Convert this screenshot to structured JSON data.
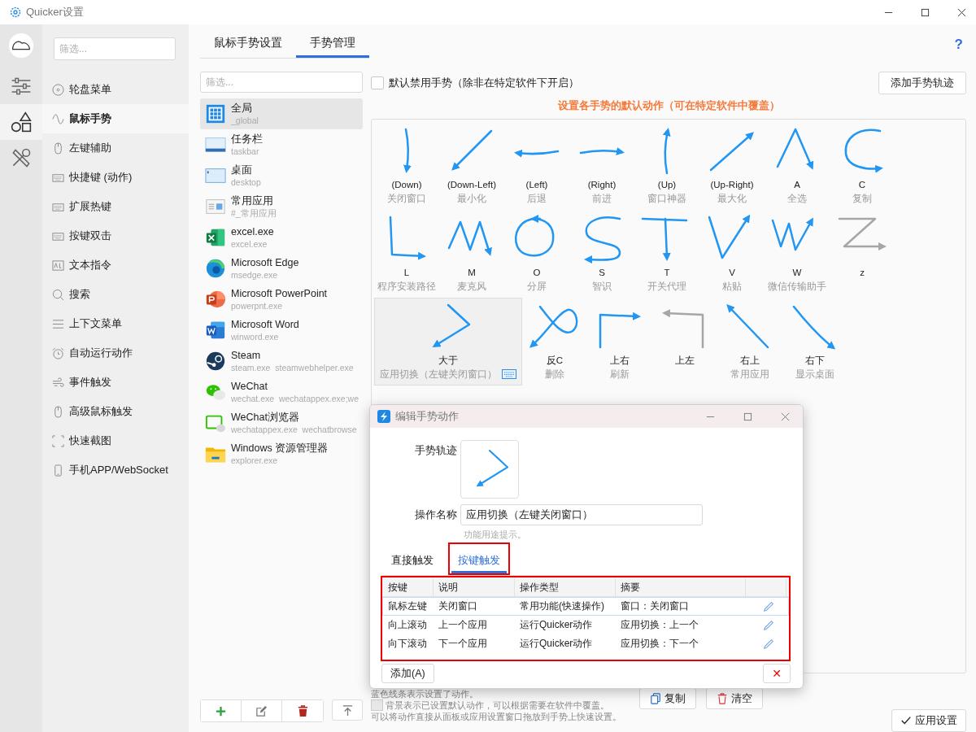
{
  "window": {
    "title": "Quicker设置"
  },
  "rail": [
    {
      "kind": "sliders",
      "selected": false
    },
    {
      "kind": "shapes",
      "selected": true
    },
    {
      "kind": "tools",
      "selected": false
    }
  ],
  "nav": {
    "filter_placeholder": "筛选...",
    "items": [
      {
        "kind": "disc",
        "label": "轮盘菜单",
        "selected": false
      },
      {
        "kind": "wave",
        "label": "鼠标手势",
        "selected": true
      },
      {
        "kind": "mouse",
        "label": "左键辅助",
        "selected": false
      },
      {
        "kind": "keyboard",
        "label": "快捷键 (动作)",
        "selected": false
      },
      {
        "kind": "keyboard",
        "label": "扩展热键",
        "selected": false
      },
      {
        "kind": "keyboard",
        "label": "按键双击",
        "selected": false
      },
      {
        "kind": "ad",
        "label": "文本指令",
        "selected": false
      },
      {
        "kind": "search",
        "label": "搜索",
        "selected": false
      },
      {
        "kind": "lines",
        "label": "上下文菜单",
        "selected": false
      },
      {
        "kind": "alarm",
        "label": "自动运行动作",
        "selected": false
      },
      {
        "kind": "wind",
        "label": "事件触发",
        "selected": false
      },
      {
        "kind": "mouse",
        "label": "高级鼠标触发",
        "selected": false
      },
      {
        "kind": "crop",
        "label": "快速截图",
        "selected": false
      },
      {
        "kind": "phone",
        "label": "手机APP/WebSocket",
        "selected": false
      }
    ]
  },
  "tabs": [
    {
      "label": "鼠标手势设置",
      "selected": false
    },
    {
      "label": "手势管理",
      "selected": true
    }
  ],
  "help": "?",
  "apps": {
    "filter_placeholder": "筛选...",
    "items": [
      {
        "kind": "global",
        "name": "全局",
        "exe": "_global",
        "selected": true
      },
      {
        "kind": "taskbar",
        "name": "任务栏",
        "exe": "taskbar",
        "selected": false
      },
      {
        "kind": "desktop",
        "name": "桌面",
        "exe": "desktop",
        "selected": false
      },
      {
        "kind": "common",
        "name": "常用应用",
        "exe": "#_常用应用",
        "selected": false
      },
      {
        "kind": "excel",
        "name": "excel.exe",
        "exe": "excel.exe",
        "selected": false
      },
      {
        "kind": "edge",
        "name": "Microsoft Edge",
        "exe": "msedge.exe",
        "selected": false
      },
      {
        "kind": "powerpoint",
        "name": "Microsoft PowerPoint",
        "exe": "powerpnt.exe",
        "selected": false
      },
      {
        "kind": "word",
        "name": "Microsoft Word",
        "exe": "winword.exe",
        "selected": false
      },
      {
        "kind": "steam",
        "name": "Steam",
        "exe": "steam.exe  steamwebhelper.exe",
        "selected": false
      },
      {
        "kind": "wechat",
        "name": "WeChat",
        "exe": "wechat.exe  wechatappex.exe;we",
        "selected": false
      },
      {
        "kind": "wechat-browser",
        "name": "WeChat浏览器",
        "exe": "wechatappex.exe  wechatbrowse",
        "selected": false
      },
      {
        "kind": "explorer",
        "name": "Windows 资源管理器",
        "exe": "explorer.exe",
        "selected": false
      }
    ]
  },
  "disable_default": {
    "label": "默认禁用手势（除非在特定软件下开启）",
    "checked": false
  },
  "add_gesture_button": "添加手势轨迹",
  "hint_title": "设置各手势的默认动作（可在特定软件中覆盖）",
  "gestures": [
    {
      "kind": "down",
      "name": "(Down)",
      "action": "关闭窗口",
      "assigned": true,
      "selected": false,
      "hotkey": false
    },
    {
      "kind": "down-left",
      "name": "(Down-Left)",
      "action": "最小化",
      "assigned": true,
      "selected": false,
      "hotkey": false
    },
    {
      "kind": "left",
      "name": "(Left)",
      "action": "后退",
      "assigned": true,
      "selected": false,
      "hotkey": false
    },
    {
      "kind": "right",
      "name": "(Right)",
      "action": "前进",
      "assigned": true,
      "selected": false,
      "hotkey": false
    },
    {
      "kind": "up",
      "name": "(Up)",
      "action": "窗口神器",
      "assigned": true,
      "selected": false,
      "hotkey": false
    },
    {
      "kind": "up-right",
      "name": "(Up-Right)",
      "action": "最大化",
      "assigned": true,
      "selected": false,
      "hotkey": false
    },
    {
      "kind": "a",
      "name": "A",
      "action": "全选",
      "assigned": true,
      "selected": false,
      "hotkey": false
    },
    {
      "kind": "c",
      "name": "C",
      "action": "复制",
      "assigned": true,
      "selected": false,
      "hotkey": false
    },
    {
      "kind": "l",
      "name": "L",
      "action": "程序安装路径",
      "assigned": true,
      "selected": false,
      "hotkey": false
    },
    {
      "kind": "m",
      "name": "M",
      "action": "麦克风",
      "assigned": true,
      "selected": false,
      "hotkey": false
    },
    {
      "kind": "o",
      "name": "O",
      "action": "分屏",
      "assigned": true,
      "selected": false,
      "hotkey": false
    },
    {
      "kind": "s",
      "name": "S",
      "action": "智识",
      "assigned": true,
      "selected": false,
      "hotkey": false
    },
    {
      "kind": "t",
      "name": "T",
      "action": "开关代理",
      "assigned": true,
      "selected": false,
      "hotkey": false
    },
    {
      "kind": "v",
      "name": "V",
      "action": "粘贴",
      "assigned": true,
      "selected": false,
      "hotkey": false
    },
    {
      "kind": "w",
      "name": "W",
      "action": "微信传输助手",
      "assigned": true,
      "selected": false,
      "hotkey": false
    },
    {
      "kind": "z",
      "name": "z",
      "assigned": false,
      "selected": false,
      "hotkey": false
    },
    {
      "kind": "gt",
      "name": "大于",
      "action": "应用切换（左键关闭窗口）",
      "assigned": true,
      "selected": true,
      "hotkey": true
    },
    {
      "kind": "reverse-c",
      "name": "反C",
      "action": "删除",
      "assigned": true,
      "selected": false,
      "hotkey": false
    },
    {
      "kind": "up-then-right",
      "name": "上右",
      "action": "刷新",
      "assigned": true,
      "selected": false,
      "hotkey": false
    },
    {
      "kind": "up-then-left",
      "name": "上左",
      "assigned": false,
      "selected": false,
      "hotkey": false
    },
    {
      "kind": "up-left",
      "name": "右上",
      "action": "常用应用",
      "assigned": true,
      "selected": false,
      "hotkey": false
    },
    {
      "kind": "down-right",
      "name": "右下",
      "action": "显示桌面",
      "assigned": true,
      "selected": false,
      "hotkey": false
    }
  ],
  "legend": [
    {
      "text": "蓝色线条表示设置了动作。",
      "swatch": false
    },
    {
      "text": "背景表示已设置默认动作，可以根据需要在软件中覆盖。",
      "swatch": true
    },
    {
      "text": "可以将动作直接从面板或应用设置窗口拖放到手势上快速设置。",
      "swatch": false
    }
  ],
  "copy_button": "复制",
  "clear_button": "清空",
  "apply_button": "应用设置",
  "dialog": {
    "title": "编辑手势动作",
    "gesture_label": "手势轨迹",
    "name_label": "操作名称",
    "name_value": "应用切换（左键关闭窗口）",
    "name_hint": "功能用途提示。",
    "tabs": [
      {
        "label": "直接触发",
        "selected": false,
        "highlighted": false
      },
      {
        "label": "按键触发",
        "selected": true,
        "highlighted": true
      }
    ],
    "table": {
      "highlighted": true,
      "columns": [
        "按键",
        "说明",
        "操作类型",
        "摘要"
      ],
      "rows": [
        {
          "cells": [
            "鼠标左键",
            "关闭窗口",
            "常用功能(快速操作)",
            "窗口：关闭窗口"
          ],
          "selected": true
        },
        {
          "cells": [
            "向上滚动",
            "上一个应用",
            "运行Quicker动作",
            "应用切换：上一个"
          ],
          "selected": false
        },
        {
          "cells": [
            "向下滚动",
            "下一个应用",
            "运行Quicker动作",
            "应用切换：下一个"
          ],
          "selected": false
        }
      ]
    },
    "add_button": "添加(A)",
    "delete_button": "✕"
  }
}
